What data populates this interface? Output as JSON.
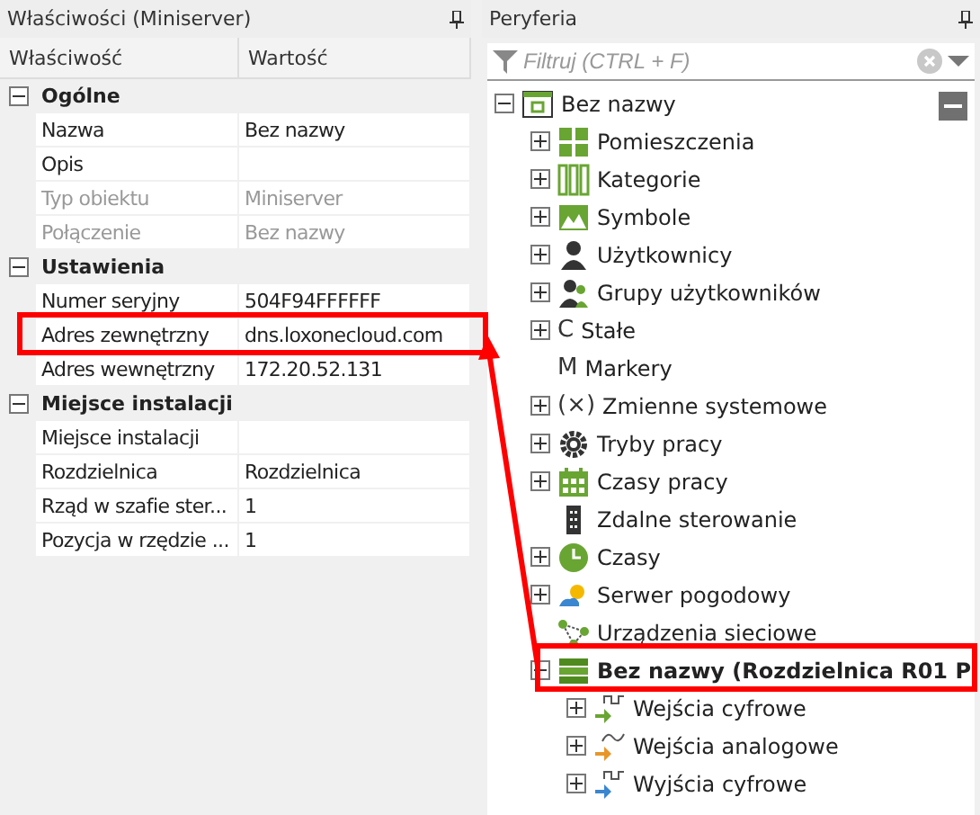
{
  "properties_panel": {
    "title": "Właściwości (Miniserver)",
    "columns": [
      "Właściwość",
      "Wartość"
    ],
    "groups": [
      {
        "name": "Ogólne",
        "expanded": true,
        "rows": [
          {
            "name": "Nazwa",
            "value": "Bez nazwy",
            "disabled": false
          },
          {
            "name": "Opis",
            "value": "",
            "disabled": false
          },
          {
            "name": "Typ obiektu",
            "value": "Miniserver",
            "disabled": true
          },
          {
            "name": "Połączenie",
            "value": "Bez nazwy",
            "disabled": true
          }
        ]
      },
      {
        "name": "Ustawienia",
        "expanded": true,
        "rows": [
          {
            "name": "Numer seryjny",
            "value": "504F94FFFFFF",
            "disabled": false
          },
          {
            "name": "Adres zewnętrzny",
            "value": "dns.loxonecloud.com",
            "disabled": false
          },
          {
            "name": "Adres wewnętrzny",
            "value": "172.20.52.131",
            "disabled": false
          }
        ]
      },
      {
        "name": "Miejsce instalacji",
        "expanded": true,
        "rows": [
          {
            "name": "Miejsce instalacji",
            "value": "",
            "disabled": false
          },
          {
            "name": "Rozdzielnica",
            "value": "Rozdzielnica",
            "disabled": false
          },
          {
            "name": "Rząd w szafie ster...",
            "value": "1",
            "disabled": false
          },
          {
            "name": "Pozycja w rzędzie ...",
            "value": "1",
            "disabled": false
          }
        ]
      }
    ]
  },
  "peripherals_panel": {
    "title": "Peryferia",
    "filter": {
      "placeholder": "Filtruj (CTRL + F)"
    },
    "tree": [
      {
        "label": "Bez nazwy",
        "kind": "miniserver",
        "expanded": true,
        "bold": false,
        "children": [
          {
            "label": "Pomieszczenia",
            "kind": "rooms",
            "expanded": false,
            "bold": false
          },
          {
            "label": "Kategorie",
            "kind": "categories",
            "expanded": false,
            "bold": false
          },
          {
            "label": "Symbole",
            "kind": "symbols",
            "expanded": false,
            "bold": false
          },
          {
            "label": "Użytkownicy",
            "kind": "user",
            "expanded": false,
            "bold": false
          },
          {
            "label": "Grupy użytkowników",
            "kind": "users",
            "expanded": false,
            "bold": false
          },
          {
            "label": "Stałe",
            "kind": "letter",
            "glyph": "C",
            "expanded": false,
            "bold": false
          },
          {
            "label": "Markery",
            "kind": "letter",
            "glyph": "M",
            "bold": false
          },
          {
            "label": "Zmienne systemowe",
            "kind": "letter",
            "glyph": "(×)",
            "expanded": false,
            "bold": false
          },
          {
            "label": "Tryby pracy",
            "kind": "gear",
            "expanded": false,
            "bold": false
          },
          {
            "label": "Czasy pracy",
            "kind": "calendar",
            "expanded": false,
            "bold": false
          },
          {
            "label": "Zdalne sterowanie",
            "kind": "remote",
            "bold": false
          },
          {
            "label": "Czasy",
            "kind": "clock",
            "expanded": false,
            "bold": false
          },
          {
            "label": "Serwer pogodowy",
            "kind": "weather",
            "expanded": false,
            "bold": false
          },
          {
            "label": "Urządzenia sieciowe",
            "kind": "network",
            "bold": false
          },
          {
            "label": "Bez nazwy (Rozdzielnica R01 P",
            "kind": "cabinet",
            "expanded": true,
            "bold": true,
            "children": [
              {
                "label": "Wejścia cyfrowe",
                "kind": "digital-in",
                "expanded": false,
                "bold": false
              },
              {
                "label": "Wejścia analogowe",
                "kind": "analog-in",
                "expanded": false,
                "bold": false
              },
              {
                "label": "Wyjścia cyfrowe",
                "kind": "digital-out",
                "expanded": false,
                "bold": false
              }
            ]
          }
        ]
      }
    ]
  }
}
